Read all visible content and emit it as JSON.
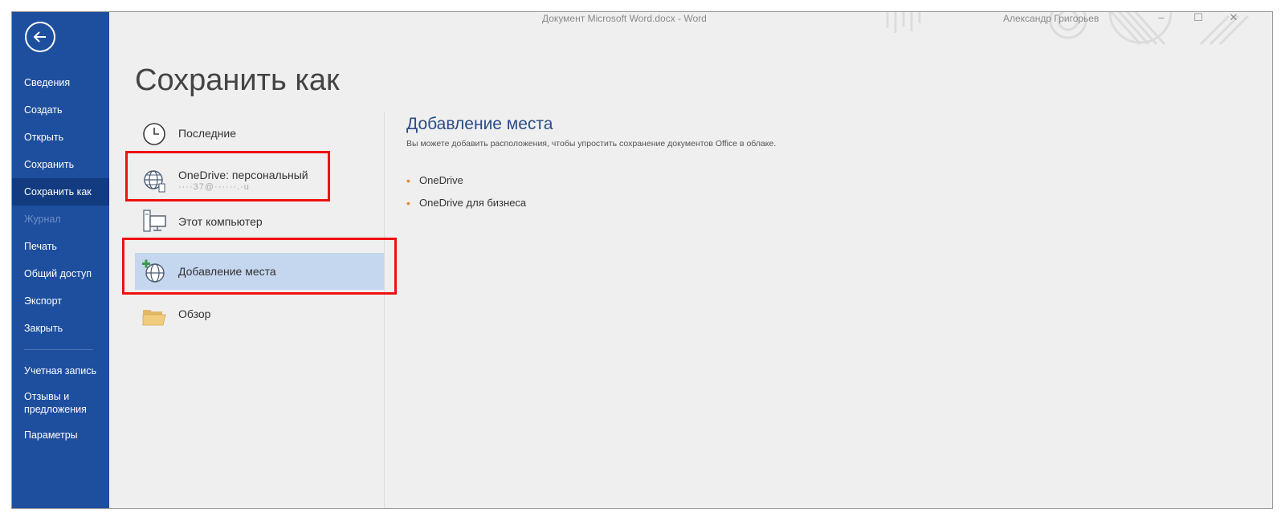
{
  "titlebar": {
    "document_title": "Документ Microsoft Word.docx  -  Word",
    "user_name": "Александр Григорьев",
    "minimize_label": "–",
    "restore_label": "☐",
    "close_label": "✕"
  },
  "sidebar": {
    "items": [
      {
        "label": "Сведения"
      },
      {
        "label": "Создать"
      },
      {
        "label": "Открыть"
      },
      {
        "label": "Сохранить"
      },
      {
        "label": "Сохранить как"
      },
      {
        "label": "Журнал"
      },
      {
        "label": "Печать"
      },
      {
        "label": "Общий доступ"
      },
      {
        "label": "Экспорт"
      },
      {
        "label": "Закрыть"
      }
    ],
    "lower_items": [
      {
        "label": "Учетная запись"
      },
      {
        "label": "Отзывы и предложения"
      },
      {
        "label": "Параметры"
      }
    ]
  },
  "page": {
    "title": "Сохранить как"
  },
  "places": {
    "recent": "Последние",
    "onedrive": "OneDrive: персональный",
    "onedrive_account": "····37@······.·u",
    "computer": "Этот компьютер",
    "add_place": "Добавление места",
    "browse": "Обзор"
  },
  "detail": {
    "title": "Добавление места",
    "description": "Вы можете добавить расположения, чтобы упростить сохранение документов Office в облаке.",
    "options": [
      {
        "label": "OneDrive"
      },
      {
        "label": "OneDrive для бизнеса"
      }
    ]
  },
  "colors": {
    "sidebar": "#1e4e9e",
    "sidebar_active": "#123b80",
    "selected_place": "#c5d6ef",
    "bullet": "#e8852b",
    "annotation": "#ee1111"
  }
}
